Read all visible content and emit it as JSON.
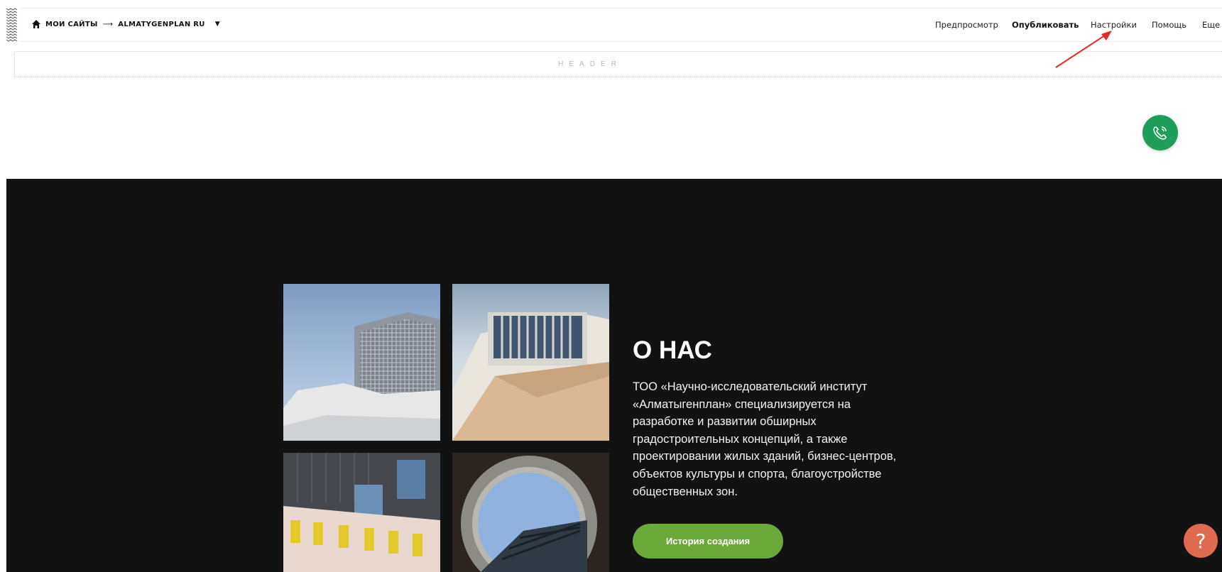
{
  "breadcrumb": {
    "home_icon": "home-icon",
    "my_sites": "мои сайты",
    "arrow": "⟶",
    "site_name": "almatygenplan ru",
    "caret": "▼"
  },
  "nav": {
    "preview": "Предпросмотр",
    "publish": "Опубликовать",
    "settings": "Настройки",
    "help": "Помощь",
    "more": "Еще"
  },
  "header_block": {
    "label": "HEADER"
  },
  "about": {
    "title": "О НАС",
    "text": "ТОО «Научно-исследовательский институт «Алматыгенплан» специализируется на разработке и развитии обширных градостроительных концепций, а также проектировании жилых зданий, бизнес-центров, объектов культуры и спорта, благоустройстве общественных зон.",
    "button": "История создания"
  },
  "help_button": "?",
  "colors": {
    "dark_bg": "#121212",
    "call_green": "#1f9d5b",
    "button_green": "#6aaa3a",
    "help_orange": "#e06a4f",
    "annotation_red": "#e8281e"
  }
}
